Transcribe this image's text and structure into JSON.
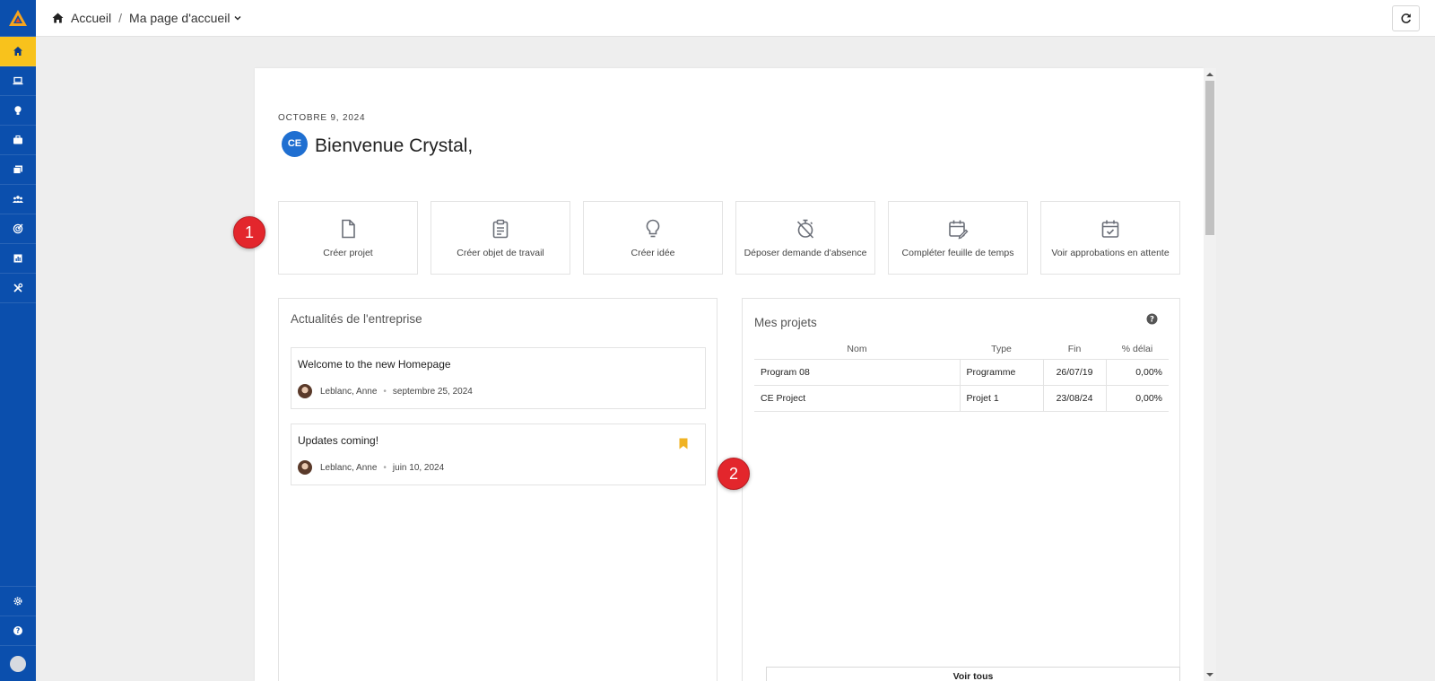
{
  "breadcrumb": {
    "home": "Accueil",
    "separator": "/",
    "current": "Ma page d'accueil"
  },
  "sidebar": {
    "items": [
      {
        "icon": "home-icon",
        "active": true
      },
      {
        "icon": "laptop-icon"
      },
      {
        "icon": "lightbulb-icon"
      },
      {
        "icon": "briefcase-icon"
      },
      {
        "icon": "folders-icon"
      },
      {
        "icon": "users-icon"
      },
      {
        "icon": "target-icon"
      },
      {
        "icon": "report-icon"
      },
      {
        "icon": "tools-icon"
      }
    ],
    "bottom": [
      {
        "icon": "gear-icon"
      },
      {
        "icon": "help-icon"
      },
      {
        "icon": "user-avatar"
      }
    ]
  },
  "header": {
    "date": "OCTOBRE 9, 2024",
    "initials": "CE",
    "welcome": "Bienvenue Crystal,"
  },
  "actions": [
    {
      "label": "Créer projet",
      "icon": "document-icon"
    },
    {
      "label": "Créer objet de travail",
      "icon": "clipboard-icon"
    },
    {
      "label": "Créer idée",
      "icon": "lightbulb-icon"
    },
    {
      "label": "Déposer demande d'absence",
      "icon": "timer-off-icon"
    },
    {
      "label": "Compléter feuille de temps",
      "icon": "calendar-edit-icon"
    },
    {
      "label": "Voir approbations en attente",
      "icon": "calendar-check-icon"
    }
  ],
  "markers": [
    "1",
    "2"
  ],
  "news": {
    "title": "Actualités de l'entreprise",
    "items": [
      {
        "title": "Welcome to the new Homepage",
        "author": "Leblanc, Anne",
        "date": "septembre 25, 2024",
        "bookmarked": false
      },
      {
        "title": "Updates coming!",
        "author": "Leblanc, Anne",
        "date": "juin 10, 2024",
        "bookmarked": true
      }
    ]
  },
  "projects": {
    "title": "Mes projets",
    "columns": [
      "Nom",
      "Type",
      "Fin",
      "% délai"
    ],
    "rows": [
      {
        "name": "Program 08",
        "type": "Programme",
        "end": "26/07/19",
        "delay": "0,00%"
      },
      {
        "name": "CE Project",
        "type": "Projet 1",
        "end": "23/08/24",
        "delay": "0,00%"
      }
    ],
    "view_all": "Voir tous"
  },
  "colors": {
    "sidebar": "#0b4fad",
    "sidebar_active": "#f8c21c",
    "accent_avatar": "#1f6fd1",
    "marker": "#e3262c",
    "bookmark": "#f0b323"
  }
}
